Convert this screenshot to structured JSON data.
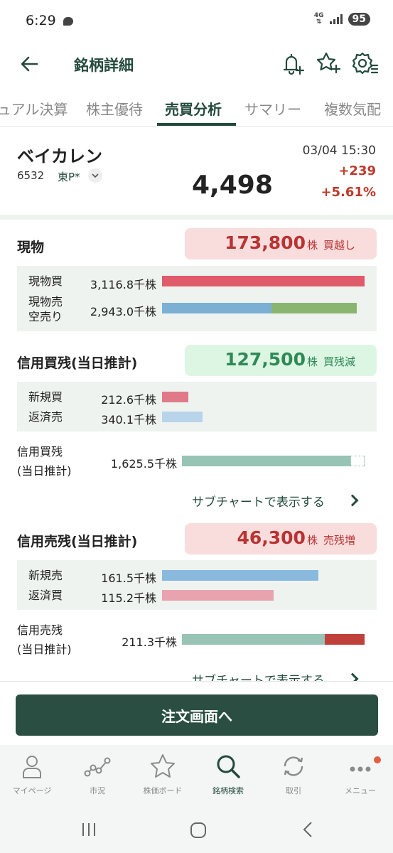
{
  "status": {
    "time": "6:29",
    "network": "4G",
    "battery": "95"
  },
  "header": {
    "title": "銘柄詳細"
  },
  "tabs": [
    "ュアル決算",
    "株主優待",
    "売買分析",
    "サマリー",
    "複数気配"
  ],
  "stock": {
    "name": "ベイカレン",
    "code": "6532",
    "market": "東P*",
    "datetime": "03/04 15:30",
    "price": "4,498",
    "change": "+239",
    "change_pct": "+5.61%"
  },
  "genbutsu": {
    "title": "現物",
    "pill_value": "173,800",
    "pill_unit": "株",
    "pill_label": "買越し",
    "rows": [
      {
        "label": "現物買",
        "value": "3,116.8千株"
      },
      {
        "label": "現物売",
        "label2": "空売り",
        "value": "2,943.0千株"
      }
    ]
  },
  "margin_buy": {
    "title": "信用買残(当日推計)",
    "pill_value": "127,500",
    "pill_unit": "株",
    "pill_label": "買残減",
    "rows": [
      {
        "label": "新規買",
        "value": "212.6千株"
      },
      {
        "label": "返済売",
        "value": "340.1千株"
      }
    ],
    "balance_label": "信用買残",
    "balance_label2": "(当日推計)",
    "balance_value": "1,625.5千株",
    "subchart": "サブチャートで表示する"
  },
  "margin_sell": {
    "title": "信用売残(当日推計)",
    "pill_value": "46,300",
    "pill_unit": "株",
    "pill_label": "売残増",
    "rows": [
      {
        "label": "新規売",
        "value": "161.5千株"
      },
      {
        "label": "返済買",
        "value": "115.2千株"
      }
    ],
    "balance_label": "信用売残",
    "balance_label2": "(当日推計)",
    "balance_value": "211.3千株",
    "subchart": "サブチャートで表示する"
  },
  "order_button": "注文画面へ",
  "nav": [
    "マイページ",
    "市況",
    "株価ボード",
    "銘柄検索",
    "取引",
    "メニュー"
  ],
  "colors": {
    "brand": "#234a3d",
    "buy_bar": "#e05b6b",
    "sell_bar": "#7bafd4",
    "short_bar": "#8ab570",
    "balance_bar": "#98c4b5",
    "margin_sell_increase": "#c0413c"
  }
}
